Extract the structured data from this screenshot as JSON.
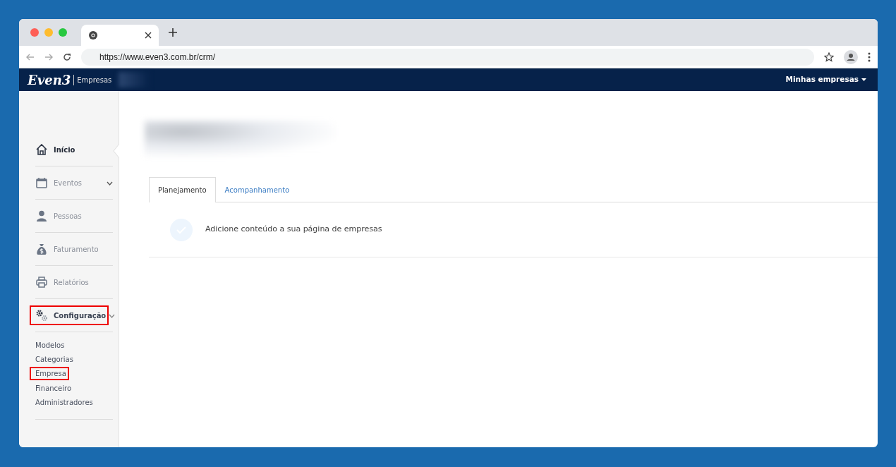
{
  "browser": {
    "url": "https://www.even3.com.br/crm/"
  },
  "navbar": {
    "logo": "Even3",
    "section": "Empresas",
    "menu": "Minhas empresas"
  },
  "sidebar": {
    "items": [
      {
        "label": "Início",
        "kind": "link",
        "selected": true,
        "highlighted": false
      },
      {
        "label": "Eventos",
        "kind": "group",
        "selected": false,
        "expanded": false,
        "highlighted": false
      },
      {
        "label": "Pessoas",
        "kind": "link",
        "selected": false,
        "highlighted": false
      },
      {
        "label": "Faturamento",
        "kind": "link",
        "selected": false,
        "highlighted": false
      },
      {
        "label": "Relatórios",
        "kind": "link",
        "selected": false,
        "highlighted": false
      },
      {
        "label": "Configuração",
        "kind": "group",
        "selected": false,
        "expanded": true,
        "highlighted": true,
        "children": [
          {
            "label": "Modelos",
            "highlighted": false
          },
          {
            "label": "Categorias",
            "highlighted": false
          },
          {
            "label": "Empresa",
            "highlighted": true
          },
          {
            "label": "Financeiro",
            "highlighted": false
          },
          {
            "label": "Administradores",
            "highlighted": false
          }
        ]
      }
    ]
  },
  "tabs": [
    {
      "label": "Planejamento",
      "selected": true
    },
    {
      "label": "Acompanhamento",
      "selected": false
    }
  ],
  "tasks": [
    {
      "text": "Adicione conteúdo a sua página de empresas"
    }
  ]
}
